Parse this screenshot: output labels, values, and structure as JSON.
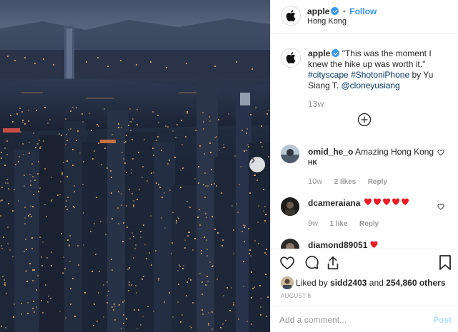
{
  "post": {
    "author": "apple",
    "follow_label": "Follow",
    "location": "Hong Kong",
    "caption": {
      "username": "apple",
      "line1": "\"This was the moment I",
      "line2": "knew the hike up was worth it.\"",
      "hashtag1": "#cityscape",
      "hashtag2": "#ShotoniPhone",
      "by_text": "by Yu",
      "line4_prefix": "Siang T.",
      "mention": "@cloneyusiang",
      "age": "13w"
    },
    "comments": [
      {
        "username": "omid_he_o",
        "text": "Amazing Hong Kong",
        "text2": "HK",
        "age": "10w",
        "likes": "2 likes",
        "reply": "Reply"
      },
      {
        "username": "dcameraiana",
        "text": "",
        "age": "9w",
        "likes": "1 like",
        "reply": "Reply"
      },
      {
        "username": "diamond89051",
        "text": ""
      }
    ],
    "likes_text_prefix": "Liked by",
    "likes_user": "sidd2403",
    "likes_and": "and",
    "likes_count": "254,860 others",
    "date": "AUGUST 8",
    "add_comment_placeholder": "Add a comment...",
    "post_label": "Post"
  },
  "colors": {
    "accent": "#3897f0",
    "heart_red": "#ed1c24",
    "muted": "#999999",
    "link": "#003569"
  }
}
